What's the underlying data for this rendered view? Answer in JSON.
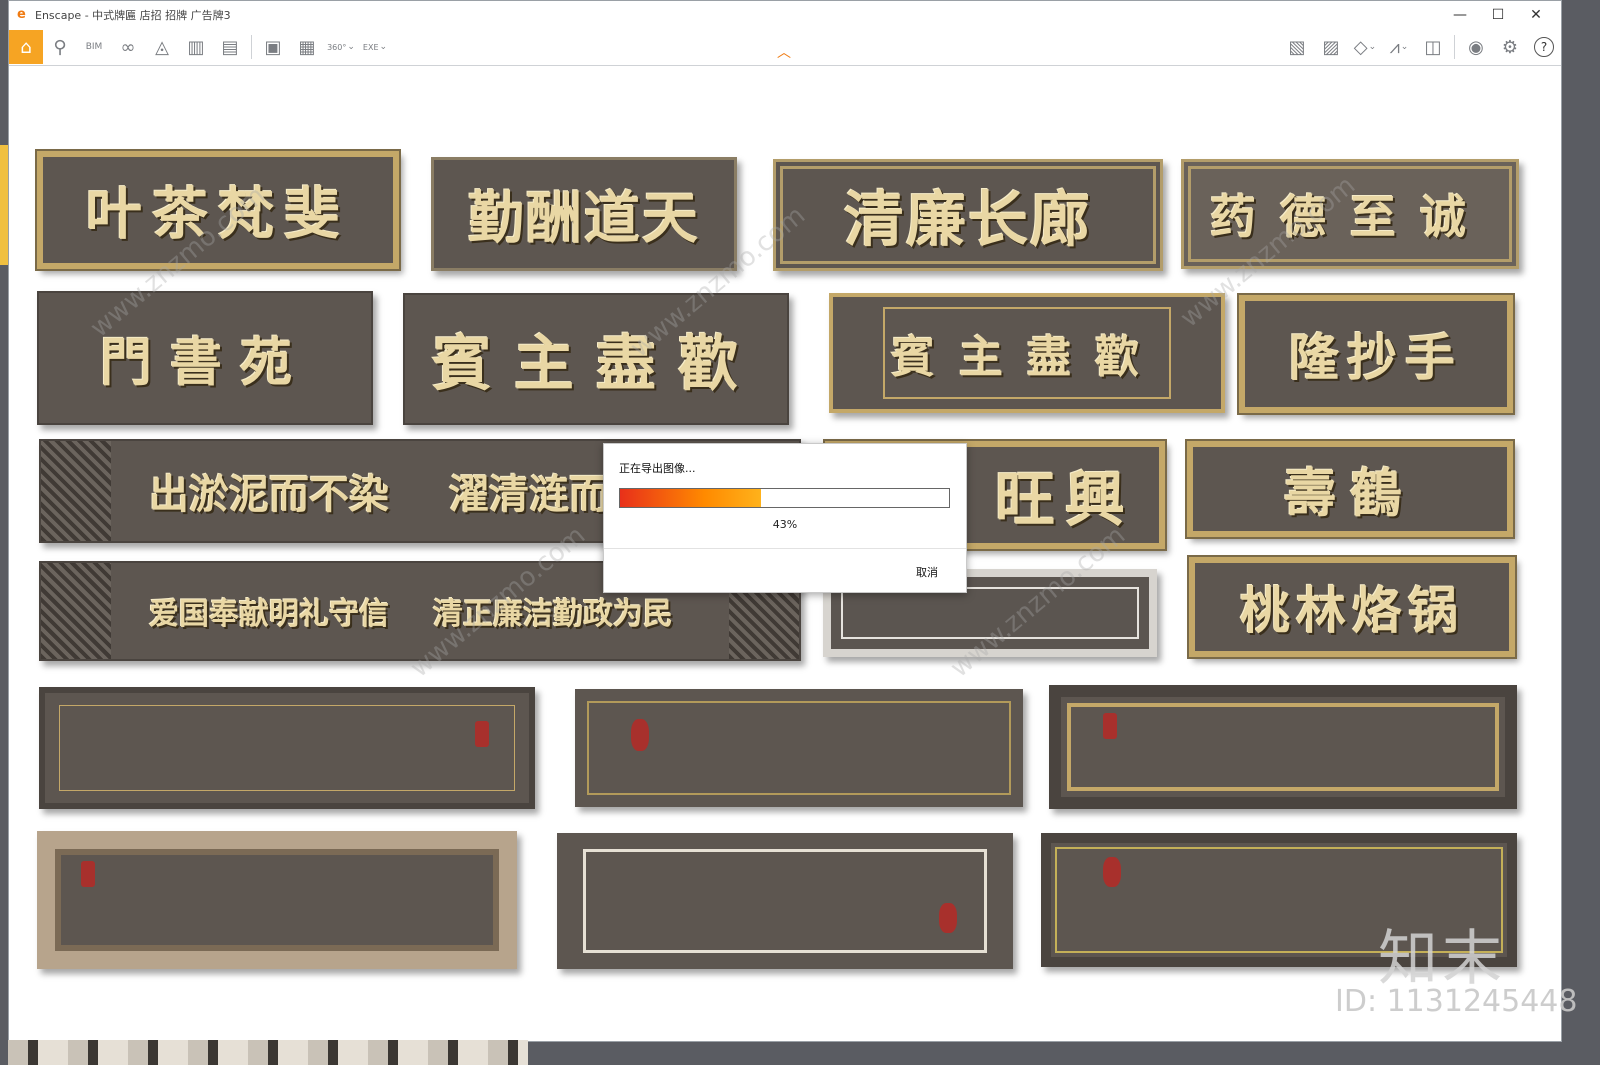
{
  "window": {
    "title": "Enscape - 中式牌匾 店招 招牌 广告牌3",
    "controls": {
      "minimize": "—",
      "maximize": "☐",
      "close": "✕"
    }
  },
  "toolbar": {
    "left_icons": [
      "home-icon",
      "live-link-icon",
      "bim-icon",
      "binoculars-icon",
      "navigation-icon",
      "buildings-icon",
      "clapper-icon",
      "screenshot-icon",
      "batch-render-icon",
      "panorama-360-icon",
      "export-exe-icon"
    ],
    "right_icons": [
      "asset-library-icon",
      "visual-settings-icon",
      "cube-icon",
      "chart-icon",
      "material-editor-icon",
      "view-icon",
      "settings-icon",
      "help-icon"
    ],
    "bim_label": "BIM",
    "pano_label": "360°",
    "exe_label": "EXE",
    "help_label": "?"
  },
  "dialog": {
    "title": "正在导出图像...",
    "progress_percent": 43,
    "progress_text": "43%",
    "cancel_label": "取消",
    "progress_colors": [
      "#e8301a",
      "#ff8a00",
      "#ffb21b"
    ]
  },
  "signs": {
    "s1": "叶茶梵斐",
    "s2": "勤酬道天",
    "s3": "清廉长廊",
    "s4": "药德至诚",
    "s5": "門書苑",
    "s6": "賓主盡歡",
    "s7": "賓主盡歡",
    "s8": "隆抄手",
    "s9a": "出淤泥而不染",
    "s9b": "濯清涟而",
    "s10": "旺興",
    "s11": "壽鶴",
    "s12a": "爱国奉献明礼守信",
    "s12b": "清正廉洁勤政为民",
    "s14": "桃林烙锅"
  },
  "watermark": {
    "logo": "知末",
    "id": "ID: 1131245448",
    "diag": "www.znzmo.com"
  }
}
